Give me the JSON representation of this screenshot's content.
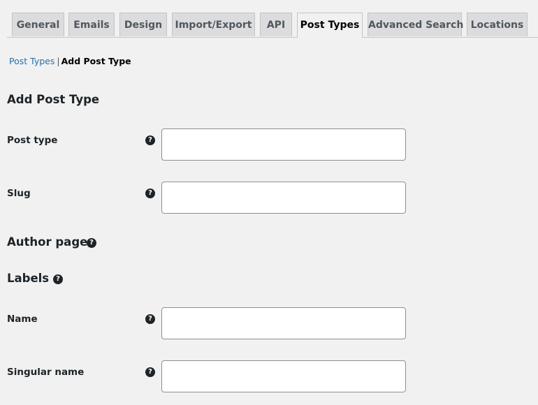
{
  "tabs": [
    {
      "label": "General",
      "active": false
    },
    {
      "label": "Emails",
      "active": false
    },
    {
      "label": "Design",
      "active": false
    },
    {
      "label": "Import/Export",
      "active": false
    },
    {
      "label": "API",
      "active": false
    },
    {
      "label": "Post Types",
      "active": true
    },
    {
      "label": "Advanced Search",
      "active": false
    },
    {
      "label": "Locations",
      "active": false
    }
  ],
  "breadcrumb": {
    "parent": "Post Types",
    "separator": "|",
    "current": "Add Post Type"
  },
  "page_title": "Add Post Type",
  "fields": {
    "post_type": {
      "label": "Post type",
      "value": "",
      "help_icon": "question-circle-icon"
    },
    "slug": {
      "label": "Slug",
      "value": "",
      "help_icon": "question-circle-icon"
    },
    "name": {
      "label": "Name",
      "value": "",
      "help_icon": "question-circle-icon"
    },
    "singular_name": {
      "label": "Singular name",
      "value": "",
      "help_icon": "question-circle-icon"
    }
  },
  "sections": {
    "author_page": {
      "heading": "Author page",
      "help_icon": "question-circle-icon"
    },
    "labels": {
      "heading": "Labels",
      "help_icon": "question-circle-icon"
    }
  },
  "help_glyph": "?",
  "colors": {
    "link": "#2271b1",
    "tab_inactive_bg": "#dcdcde",
    "page_bg": "#f1f1f1",
    "help_icon_bg": "#1d2327"
  }
}
